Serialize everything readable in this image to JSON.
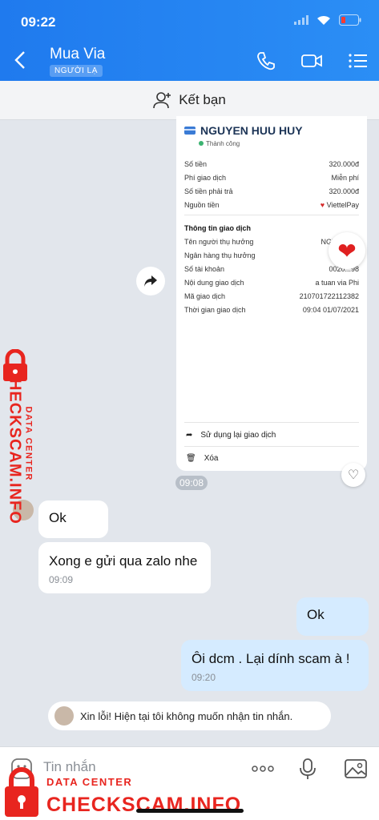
{
  "status": {
    "time": "09:22"
  },
  "header": {
    "title": "Mua Via",
    "badge": "NGƯỜI LẠ"
  },
  "addbar": {
    "label": "Kết bạn"
  },
  "receipt": {
    "name": "NGUYEN HUU HUY",
    "status": "Thành công",
    "rows": [
      {
        "label": "Số tiền",
        "value": "320.000đ"
      },
      {
        "label": "Phí giao dịch",
        "value": "Miễn phí"
      },
      {
        "label": "Số tiền phải trả",
        "value": "320.000đ"
      },
      {
        "label": "Nguồn tiền",
        "value": "ViettelPay"
      }
    ],
    "section_title": "Thông tin giao dịch",
    "details": [
      {
        "label": "Tên người thụ hưởng",
        "value": "NGUYEN H"
      },
      {
        "label": "Ngân hàng thụ hưởng",
        "value": ""
      },
      {
        "label": "Số tài khoản",
        "value": "0020...98"
      },
      {
        "label": "Nội dung giao dịch",
        "value": "a tuan via Phi"
      },
      {
        "label": "Mã giao dịch",
        "value": "210701722112382"
      },
      {
        "label": "Thời gian giao dịch",
        "value": "09:04 01/07/2021"
      }
    ],
    "actions": [
      "Sử dụng lại giao dịch",
      "Xóa"
    ],
    "time": "09:08"
  },
  "messages": [
    {
      "text": "Ok",
      "time": ""
    },
    {
      "text": "Xong e gửi qua zalo nhe",
      "time": "09:09"
    },
    {
      "text": "Ok",
      "time": ""
    },
    {
      "text": "Ôi dcm . Lại dính scam à !",
      "time": "09:20"
    }
  ],
  "system_message": "Xin lỗi! Hiện tại tôi không muốn nhận tin nhắn.",
  "input": {
    "placeholder": "Tin nhắn"
  },
  "watermark": {
    "line1": "DATA CENTER",
    "line2": "CHECKSCAM.INFO"
  },
  "colors": {
    "header": "#2b8ef5",
    "watermark": "#e8251f",
    "outgoing": "#d5ebff"
  }
}
